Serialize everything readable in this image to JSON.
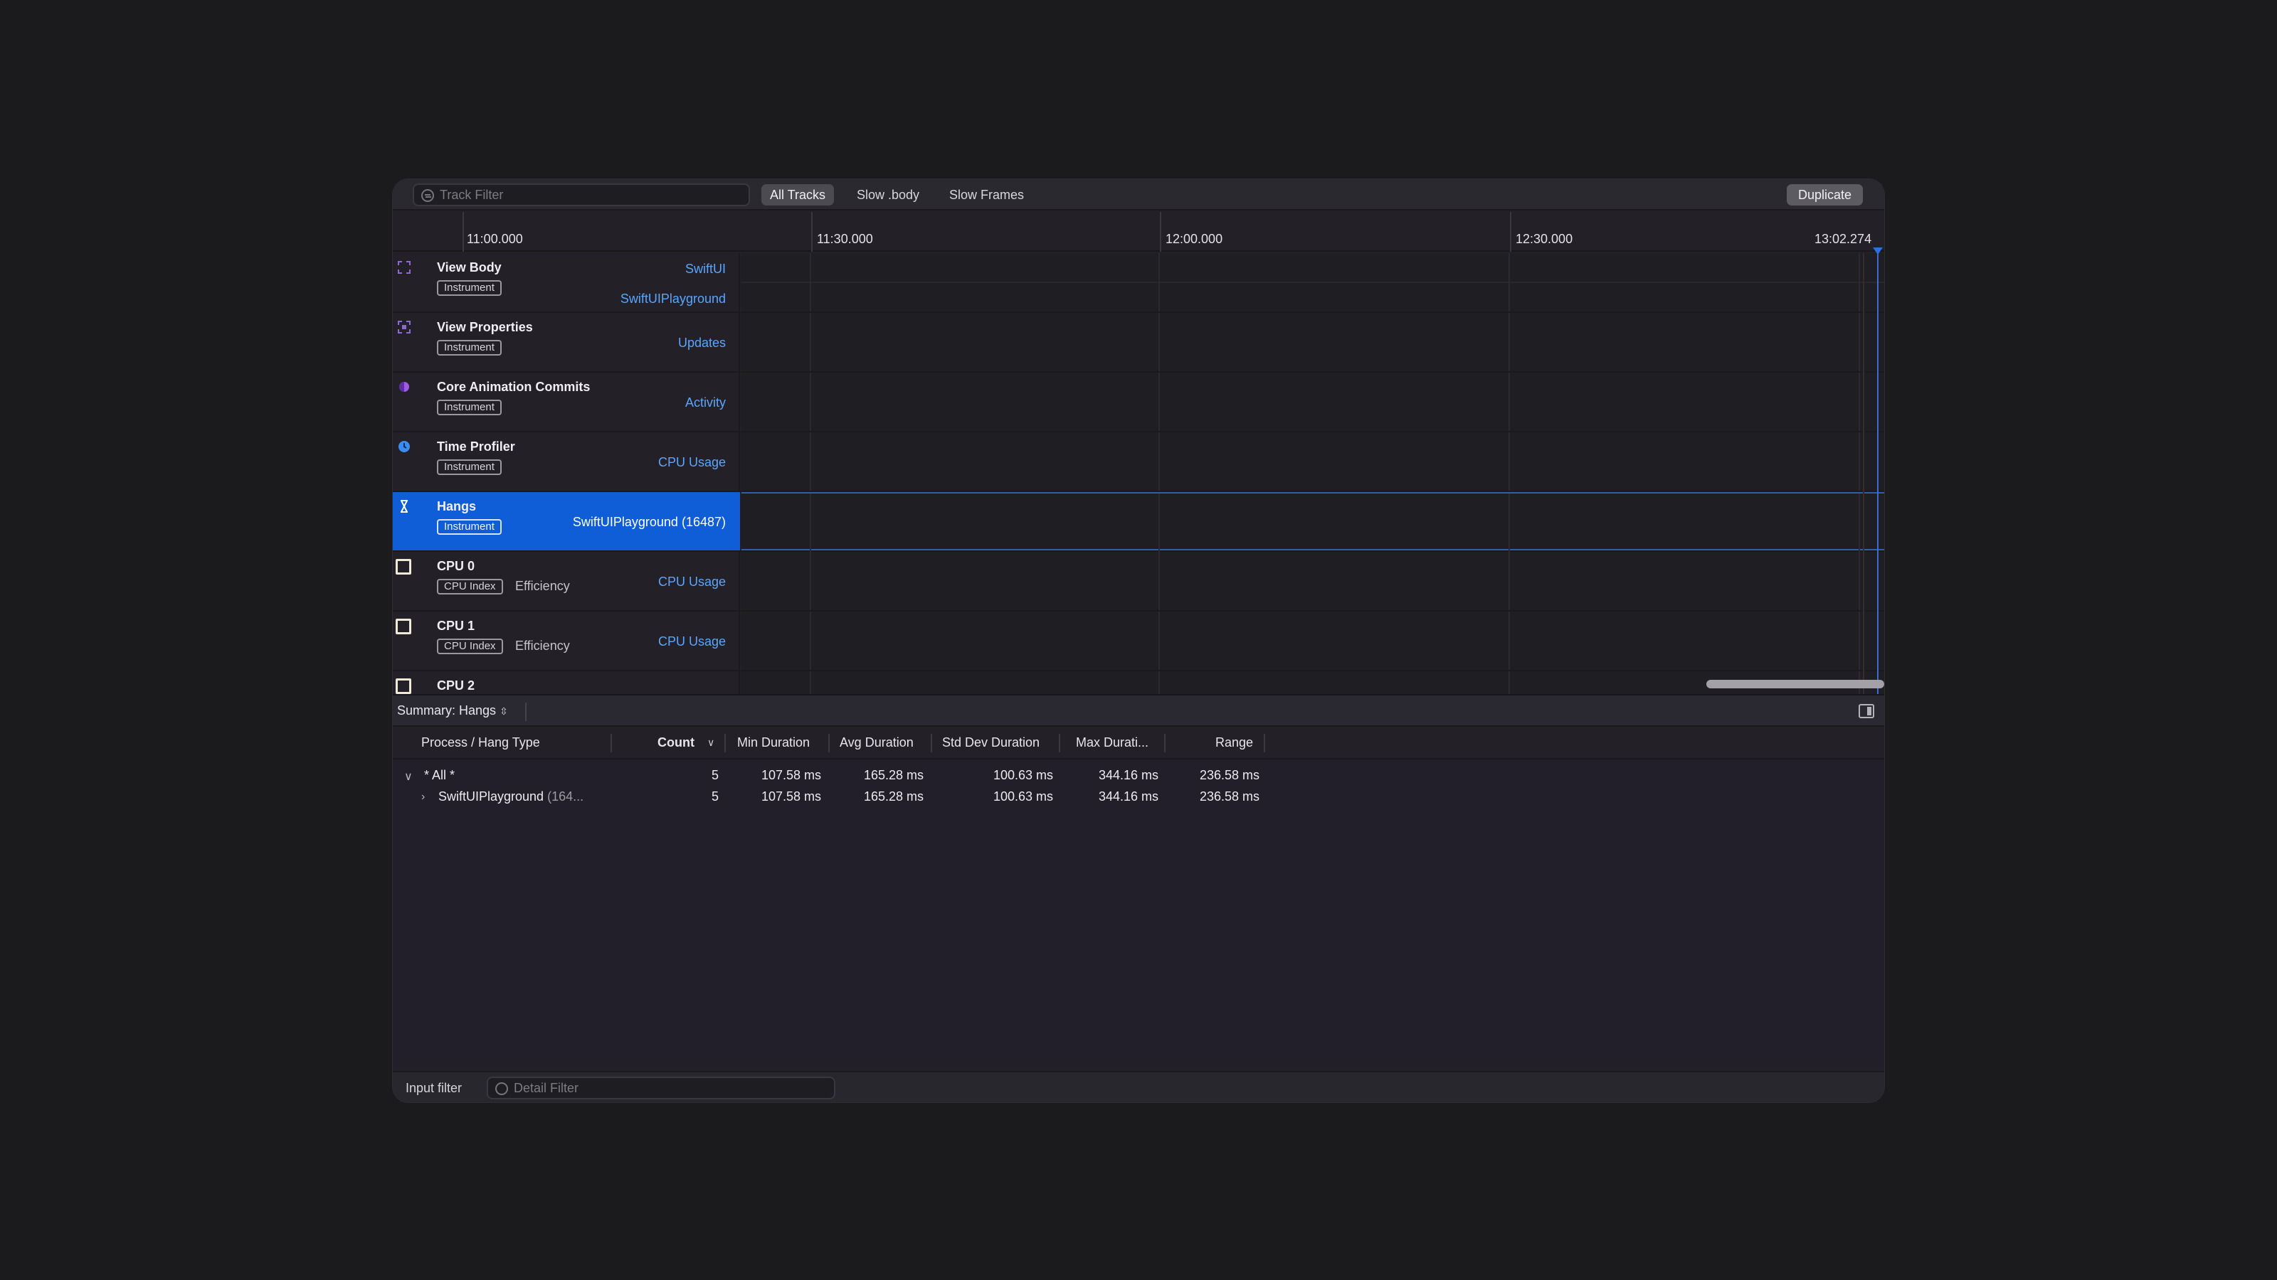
{
  "toolbar": {
    "track_filter_placeholder": "Track Filter",
    "scopes": [
      "All Tracks",
      "Slow .body",
      "Slow Frames"
    ],
    "active_scope": "All Tracks",
    "duplicate_label": "Duplicate"
  },
  "ruler": {
    "ticks": [
      "11:00.000",
      "11:30.000",
      "12:00.000",
      "12:30.000"
    ],
    "end_label": "13:02.274"
  },
  "tracks": [
    {
      "name": "View Body",
      "badge": "Instrument",
      "right": "SwiftUI",
      "right2": "SwiftUIPlayground",
      "icon": "swiftui-view-body-icon",
      "color": "#8b6ad6"
    },
    {
      "name": "View Properties",
      "badge": "Instrument",
      "right": "Updates",
      "icon": "view-properties-icon",
      "color": "#8b6ad6"
    },
    {
      "name": "Core Animation Commits",
      "badge": "Instrument",
      "right": "Activity",
      "icon": "core-animation-icon",
      "color": "#a159e8"
    },
    {
      "name": "Time Profiler",
      "badge": "Instrument",
      "right": "CPU Usage",
      "icon": "time-profiler-icon",
      "color": "#3a8cf0"
    },
    {
      "name": "Hangs",
      "badge": "Instrument",
      "right": "SwiftUIPlayground (16487)",
      "icon": "hourglass-icon",
      "color": "#ffffff",
      "selected": true
    },
    {
      "name": "CPU 0",
      "badge": "CPU Index",
      "extra": "Efficiency",
      "right": "CPU Usage",
      "icon": "cpu-icon",
      "color": "#efe9d6"
    },
    {
      "name": "CPU 1",
      "badge": "CPU Index",
      "extra": "Efficiency",
      "right": "CPU Usage",
      "icon": "cpu-icon",
      "color": "#efe9d6"
    },
    {
      "name": "CPU 2",
      "icon": "cpu-icon",
      "color": "#efe9d6"
    }
  ],
  "summary": {
    "label": "Summary: Hangs",
    "columns": [
      "Process / Hang Type",
      "Count",
      "Min Duration",
      "Avg Duration",
      "Std Dev Duration",
      "Max Durati...",
      "Range"
    ],
    "rows": [
      {
        "name": "* All *",
        "name_dim": "",
        "count": "5",
        "min": "107.58 ms",
        "avg": "165.28 ms",
        "std": "100.63 ms",
        "max": "344.16 ms",
        "range": "236.58 ms",
        "expanded": true
      },
      {
        "name": "SwiftUIPlayground",
        "name_dim": " (164...",
        "count": "5",
        "min": "107.58 ms",
        "avg": "165.28 ms",
        "std": "100.63 ms",
        "max": "344.16 ms",
        "range": "236.58 ms",
        "expanded": false
      }
    ]
  },
  "footer": {
    "input_filter_label": "Input filter",
    "detail_filter_placeholder": "Detail Filter"
  }
}
